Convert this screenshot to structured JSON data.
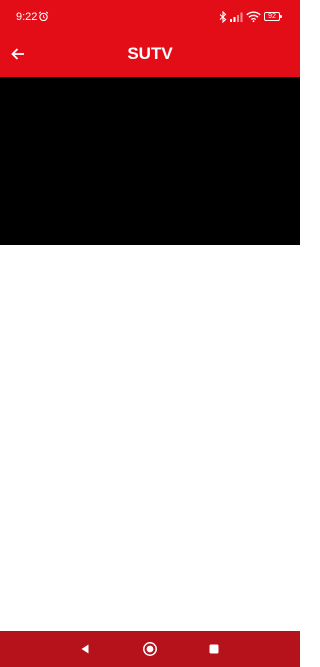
{
  "status_bar": {
    "time": "9:22",
    "battery": "92",
    "icons": [
      "alarm-icon",
      "bluetooth-icon",
      "signal-icon",
      "wifi-icon",
      "battery-icon"
    ]
  },
  "app_bar": {
    "title": "SUTV",
    "back_icon": "arrow-left-icon"
  },
  "nav_bar": {
    "icons": [
      "nav-back-icon",
      "nav-home-icon",
      "nav-recents-icon"
    ]
  },
  "colors": {
    "primary": "#e30d18",
    "nav_bar": "#b5121b",
    "player_background": "#000000",
    "content_background": "#ffffff"
  }
}
